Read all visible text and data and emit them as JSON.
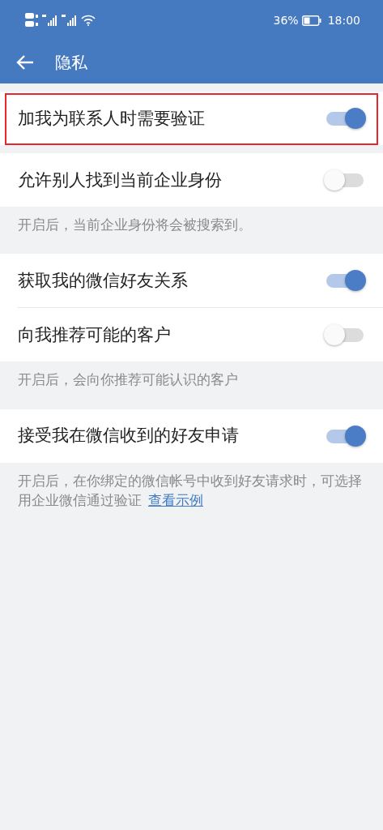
{
  "status_bar": {
    "battery": "36%",
    "time": "18:00"
  },
  "app_bar": {
    "title": "隐私"
  },
  "sections": [
    {
      "items": [
        {
          "label": "加我为联系人时需要验证",
          "on": true,
          "highlighted": true
        }
      ]
    },
    {
      "items": [
        {
          "label": "允许别人找到当前企业身份",
          "on": false,
          "highlighted": false
        }
      ],
      "note": {
        "text": "开启后，当前企业身份将会被搜索到。"
      }
    },
    {
      "items": [
        {
          "label": "获取我的微信好友关系",
          "on": true,
          "highlighted": false
        },
        {
          "label": "向我推荐可能的客户",
          "on": false,
          "highlighted": false
        }
      ],
      "note": {
        "text": "开启后，会向你推荐可能认识的客户"
      }
    },
    {
      "items": [
        {
          "label": "接受我在微信收到的好友申请",
          "on": true,
          "highlighted": false
        }
      ],
      "note": {
        "text": "开启后，在你绑定的微信帐号中收到好友请求时，可选择用企业微信通过验证",
        "link": "查看示例"
      }
    }
  ]
}
